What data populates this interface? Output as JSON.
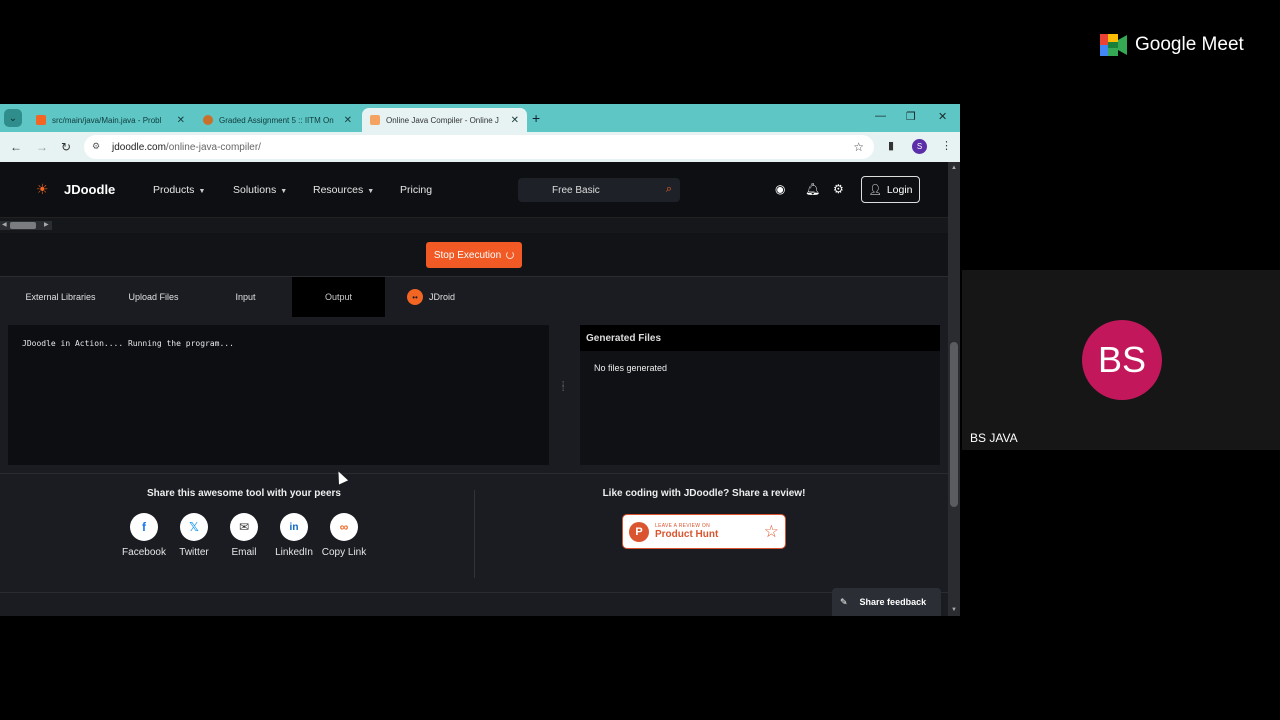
{
  "meet": {
    "app_name": "Google Meet",
    "participant_initials": "BS",
    "participant_name": "BS JAVA"
  },
  "browser": {
    "tabs": [
      {
        "title": "src/main/java/Main.java - Probl",
        "favicon_color": "#f26522"
      },
      {
        "title": "Graded Assignment 5 :: IITM On",
        "favicon_color": "#c9702a"
      },
      {
        "title": "Online Java Compiler - Online J",
        "favicon_color": "#f4a460"
      }
    ],
    "url_domain": "jdoodle.com",
    "url_path": "/online-java-compiler/",
    "profile_initial": "S"
  },
  "navbar": {
    "brand": "JDoodle",
    "items": [
      "Products",
      "Solutions",
      "Resources",
      "Pricing"
    ],
    "search_text": "Free Basic",
    "login_label": "Login"
  },
  "execution": {
    "stop_label": "Stop Execution"
  },
  "io_tabs": [
    "External Libraries",
    "Upload Files",
    "Input",
    "Output",
    "JDroid"
  ],
  "output": {
    "text": "JDoodle in Action.... Running the program..."
  },
  "files": {
    "title": "Generated Files",
    "empty_text": "No files generated"
  },
  "share": {
    "title": "Share this awesome tool with your peers",
    "items": [
      "Facebook",
      "Twitter",
      "Email",
      "LinkedIn",
      "Copy Link"
    ]
  },
  "review": {
    "title": "Like coding with JDoodle? Share a review!",
    "badge_small": "LEAVE A REVIEW ON",
    "badge_big": "Product Hunt"
  },
  "feedback_label": "Share feedback",
  "colors": {
    "accent": "#f15a24",
    "meet_avatar": "#c2185b",
    "tabbar": "#5ec7c5"
  }
}
